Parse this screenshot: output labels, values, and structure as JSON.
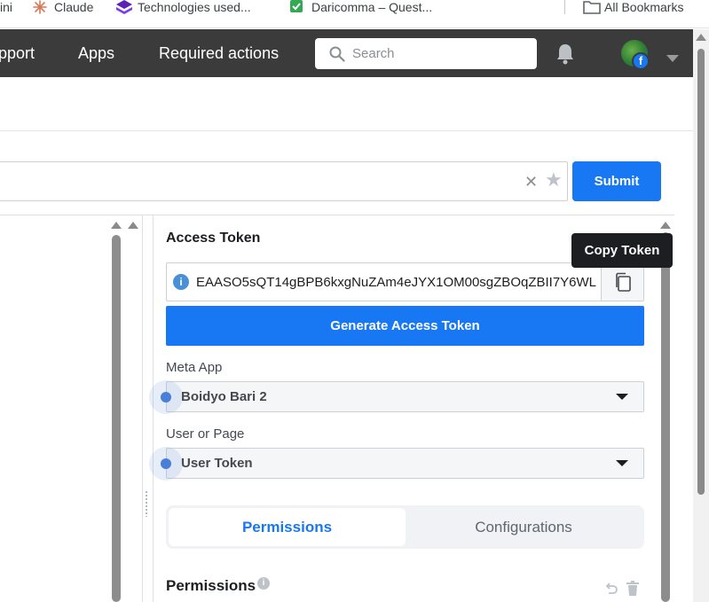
{
  "bookmarks": {
    "items": [
      {
        "label": "ini",
        "icon": "bookmark-partial"
      },
      {
        "label": "Claude",
        "icon": "claude-icon"
      },
      {
        "label": "Technologies used...",
        "icon": "purple-stack-icon"
      },
      {
        "label": "Daricomma – Quest...",
        "icon": "green-check-icon"
      }
    ],
    "all_bookmarks": "All Bookmarks"
  },
  "header": {
    "nav": [
      "pport",
      "Apps",
      "Required actions"
    ],
    "search_placeholder": "Search"
  },
  "url_bar": {
    "submit_label": "Submit"
  },
  "panel": {
    "access_token_heading": "Access Token",
    "token_value": "EAASO5sQT14gBPB6kxgNuZAm4eJYX1OM00sgZBOqZBII7Y6WL",
    "copy_tooltip": "Copy Token",
    "generate_label": "Generate Access Token",
    "meta_app_label": "Meta App",
    "meta_app_value": "Boidyo Bari 2",
    "user_page_label": "User or Page",
    "user_page_value": "User Token",
    "tabs": [
      "Permissions",
      "Configurations"
    ],
    "permissions_heading": "Permissions"
  },
  "colors": {
    "brand_blue": "#1877f2",
    "header_bg": "#3b3b3b"
  }
}
